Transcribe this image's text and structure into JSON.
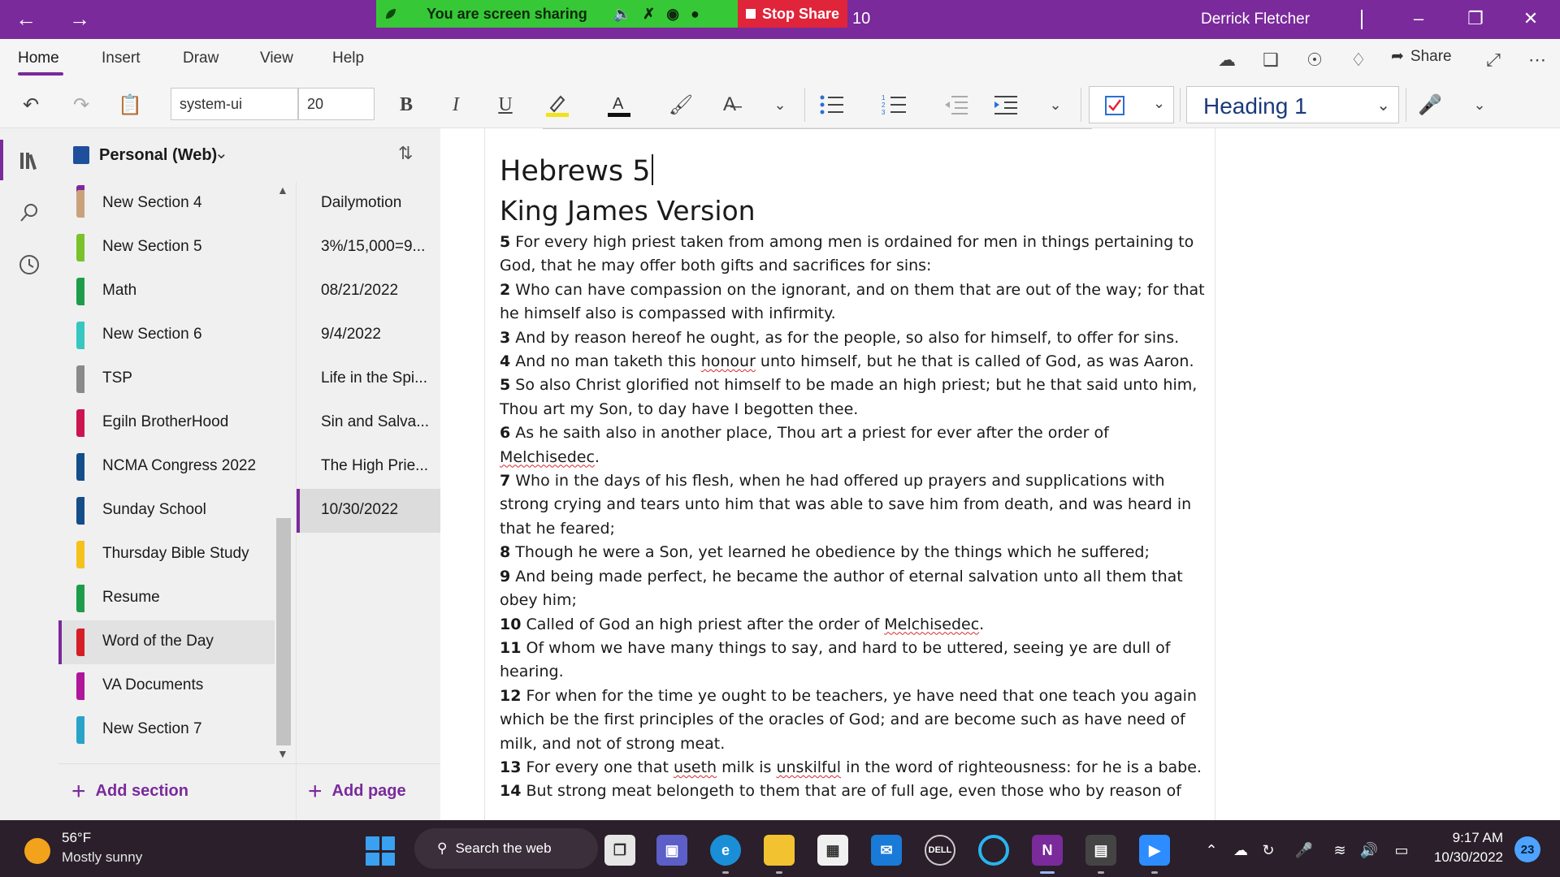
{
  "titlebar": {
    "back_icon": "arrow-left-icon",
    "forward_icon": "arrow-right-icon",
    "screen_sharing_text": "You are screen sharing",
    "stop_share_label": "Stop Share",
    "participant_count": "10",
    "user_name": "Derrick Fletcher",
    "colors": {
      "titlebar": "#7a2a9b",
      "share_banner": "#37c837",
      "stop_share": "#e0243a"
    }
  },
  "menu": {
    "tabs": [
      "Home",
      "Insert",
      "Draw",
      "View",
      "Help"
    ],
    "active_tab": "Home",
    "share_label": "Share"
  },
  "ribbon": {
    "font_name": "system-ui",
    "font_size": "20",
    "style": "Heading 1"
  },
  "notebook": {
    "title": "Personal (Web)"
  },
  "sections": {
    "items": [
      {
        "label": "New Section 4",
        "color": "#c9a27b"
      },
      {
        "label": "New Section 5",
        "color": "#7ac22b"
      },
      {
        "label": "Math",
        "color": "#1f9c4a"
      },
      {
        "label": "New Section 6",
        "color": "#35c7c0"
      },
      {
        "label": "TSP",
        "color": "#8a8a8a"
      },
      {
        "label": "Egiln BrotherHood",
        "color": "#cc1550"
      },
      {
        "label": "NCMA Congress 2022",
        "color": "#134d8a"
      },
      {
        "label": "Sunday School",
        "color": "#134d8a"
      },
      {
        "label": "Thursday Bible Study",
        "color": "#f4c21a"
      },
      {
        "label": "Resume",
        "color": "#1f9c4a"
      },
      {
        "label": "Word of the Day",
        "color": "#d41f26"
      },
      {
        "label": "VA Documents",
        "color": "#b0159a"
      },
      {
        "label": "New Section 7",
        "color": "#2aa3c9"
      }
    ],
    "selected": "Word of the Day",
    "add_label": "Add section"
  },
  "pages": {
    "items": [
      "Dailymotion",
      "3%/15,000=9...",
      "08/21/2022",
      "9/4/2022",
      "Life in the Spi...",
      "Sin and Salva...",
      "The High Prie...",
      "10/30/2022"
    ],
    "selected": "10/30/2022",
    "add_label": "Add page"
  },
  "note": {
    "title": "Hebrews 5",
    "subtitle": "King James Version",
    "verses": [
      {
        "num": "5",
        "text": " For every high priest taken from among men is ordained for men in things pertaining to God, that he may offer both gifts and sacrifices for sins:"
      },
      {
        "num": "2",
        "text": " Who can have compassion on the ignorant, and on them that are out of the way; for that he himself also is compassed with infirmity."
      },
      {
        "num": "3",
        "text": " And by reason hereof he ought, as for the people, so also for himself, to offer for sins."
      },
      {
        "num": "4",
        "text": " And no man taketh this honour unto himself, but he that is called of God, as was Aaron."
      },
      {
        "num": "5",
        "text": " So also Christ glorified not himself to be made an high priest; but he that said unto him, Thou art my Son, to day have I begotten thee."
      },
      {
        "num": "6",
        "text": " As he saith also in another place, Thou art a priest for ever after the order of Melchisedec."
      },
      {
        "num": "7",
        "text": " Who in the days of his flesh, when he had offered up prayers and supplications with strong crying and tears unto him that was able to save him from death, and was heard in that he feared;"
      },
      {
        "num": "8",
        "text": " Though he were a Son, yet learned he obedience by the things which he suffered;"
      },
      {
        "num": "9",
        "text": " And being made perfect, he became the author of eternal salvation unto all them that obey him;"
      },
      {
        "num": "10",
        "text": " Called of God an high priest after the order of Melchisedec."
      },
      {
        "num": "11",
        "text": " Of whom we have many things to say, and hard to be uttered, seeing ye are dull of hearing."
      },
      {
        "num": "12",
        "text": " For when for the time ye ought to be teachers, ye have need that one teach you again which be the first principles of the oracles of God; and are become such as have need of milk, and not of strong meat."
      },
      {
        "num": "13",
        "text": " For every one that useth milk is unskilful in the word of righteousness: for he is a babe."
      },
      {
        "num": "14",
        "text": " But strong meat belongeth to them that are of full age, even those who by reason of"
      }
    ]
  },
  "taskbar": {
    "weather_temp": "56°F",
    "weather_desc": "Mostly sunny",
    "search_placeholder": "Search the web",
    "time": "9:17 AM",
    "date": "10/30/2022",
    "notification_count": "23"
  }
}
